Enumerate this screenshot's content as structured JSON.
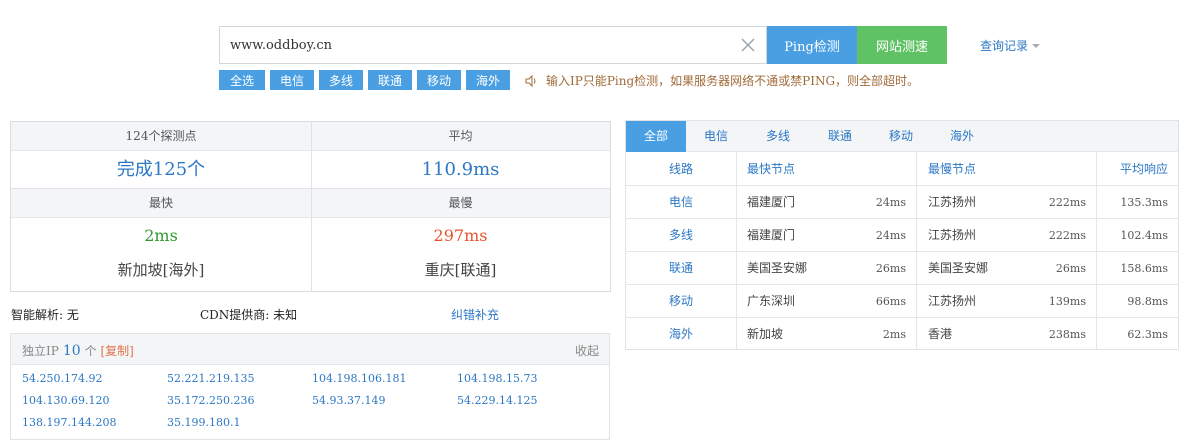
{
  "search": {
    "value": "www.oddboy.cn"
  },
  "buttons": {
    "ping": "Ping检测",
    "speed": "网站测速"
  },
  "history": {
    "label": "查询记录"
  },
  "chips": [
    "全选",
    "电信",
    "多线",
    "联通",
    "移动",
    "海外"
  ],
  "notice": "输入IP只能Ping检测，如果服务器网络不通或禁PING，则全部超时。",
  "summary": {
    "probes_label": "124个探测点",
    "completed": "完成125个",
    "avg_label": "平均",
    "avg_value": "110.9ms",
    "fast_label": "最快",
    "fast_value": "2ms",
    "fast_loc": "新加坡[海外]",
    "slow_label": "最慢",
    "slow_value": "297ms",
    "slow_loc": "重庆[联通]"
  },
  "meta": {
    "dns": "智能解析: 无",
    "cdn": "CDN提供商: 未知",
    "report": "纠错补充"
  },
  "ip_panel": {
    "label": "独立IP",
    "count": "10",
    "unit": "个",
    "copy": "[复制]",
    "collapse": "收起",
    "ips": [
      "54.250.174.92",
      "52.221.219.135",
      "104.198.106.181",
      "104.198.15.73",
      "104.130.69.120",
      "35.172.250.236",
      "54.93.37.149",
      "54.229.14.125",
      "138.197.144.208",
      "35.199.180.1"
    ]
  },
  "right": {
    "tabs": [
      "全部",
      "电信",
      "多线",
      "联通",
      "移动",
      "海外"
    ],
    "headers": {
      "line": "线路",
      "fastest": "最快节点",
      "slowest": "最慢节点",
      "avg": "平均响应"
    },
    "rows": [
      {
        "line": "电信",
        "fast_node": "福建厦门",
        "fast_ms": "24ms",
        "slow_node": "江苏扬州",
        "slow_ms": "222ms",
        "avg": "135.3ms"
      },
      {
        "line": "多线",
        "fast_node": "福建厦门",
        "fast_ms": "24ms",
        "slow_node": "江苏扬州",
        "slow_ms": "222ms",
        "avg": "102.4ms"
      },
      {
        "line": "联通",
        "fast_node": "美国圣安娜",
        "fast_ms": "26ms",
        "slow_node": "美国圣安娜",
        "slow_ms": "26ms",
        "avg": "158.6ms"
      },
      {
        "line": "移动",
        "fast_node": "广东深圳",
        "fast_ms": "66ms",
        "slow_node": "江苏扬州",
        "slow_ms": "139ms",
        "avg": "98.8ms"
      },
      {
        "line": "海外",
        "fast_node": "新加坡",
        "fast_ms": "2ms",
        "slow_node": "香港",
        "slow_ms": "238ms",
        "avg": "62.3ms"
      }
    ]
  },
  "colors": {
    "accent_blue": "#4a9fe3",
    "accent_green": "#5fc265",
    "link": "#2c78c6",
    "fast": "#2e9a2e",
    "slow": "#e8532b"
  }
}
